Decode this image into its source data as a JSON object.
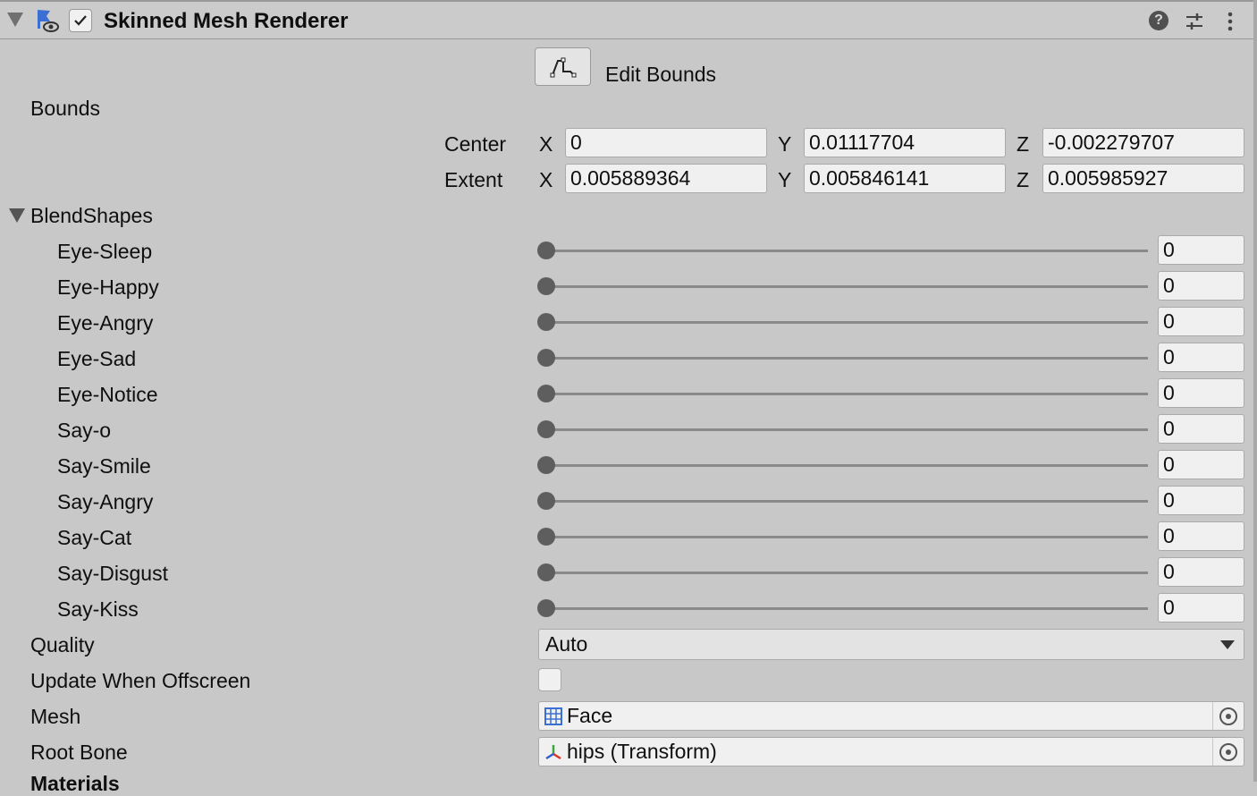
{
  "header": {
    "title": "Skinned Mesh Renderer",
    "enabled": true,
    "help_glyph": "?",
    "icons": [
      "component-icon",
      "help-icon",
      "presets-icon",
      "more-icon"
    ]
  },
  "edit_bounds": {
    "label": "Edit Bounds",
    "icon": "edit-bounds-icon"
  },
  "bounds": {
    "label": "Bounds",
    "center": {
      "label": "Center",
      "x_axis": "X",
      "y_axis": "Y",
      "z_axis": "Z",
      "x": "0",
      "y": "0.01117704",
      "z": "-0.002279707"
    },
    "extent": {
      "label": "Extent",
      "x_axis": "X",
      "y_axis": "Y",
      "z_axis": "Z",
      "x": "0.005889364",
      "y": "0.005846141",
      "z": "0.005985927"
    }
  },
  "blendshapes": {
    "label": "BlendShapes",
    "expanded": true,
    "items": [
      {
        "label": "Eye-Sleep",
        "value": "0"
      },
      {
        "label": "Eye-Happy",
        "value": "0"
      },
      {
        "label": "Eye-Angry",
        "value": "0"
      },
      {
        "label": "Eye-Sad",
        "value": "0"
      },
      {
        "label": "Eye-Notice",
        "value": "0"
      },
      {
        "label": "Say-o",
        "value": "0"
      },
      {
        "label": "Say-Smile",
        "value": "0"
      },
      {
        "label": "Say-Angry",
        "value": "0"
      },
      {
        "label": "Say-Cat",
        "value": "0"
      },
      {
        "label": "Say-Disgust",
        "value": "0"
      },
      {
        "label": "Say-Kiss",
        "value": "0"
      }
    ]
  },
  "quality": {
    "label": "Quality",
    "value": "Auto"
  },
  "update_when_offscreen": {
    "label": "Update When Offscreen",
    "checked": false
  },
  "mesh": {
    "label": "Mesh",
    "value": "Face",
    "icon": "mesh-icon"
  },
  "root_bone": {
    "label": "Root Bone",
    "value": "hips (Transform)",
    "icon": "transform-icon"
  },
  "next_section": {
    "label": "Materials"
  },
  "colors": {
    "background": "#c8c8c8",
    "field": "#f0f0f0",
    "slider_knob": "#5e5e5e",
    "accent_blue": "#3b6fd4"
  }
}
